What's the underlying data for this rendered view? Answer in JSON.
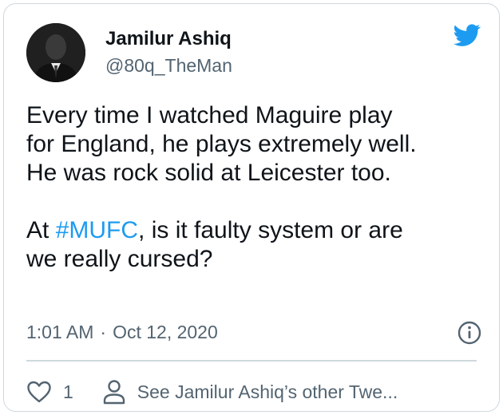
{
  "author": {
    "name": "Jamilur Ashiq",
    "handle": "@80q_TheMan"
  },
  "tweet": {
    "text_before_hashtag": "Every time I watched Maguire play\nfor England, he plays extremely well.\nHe was rock solid at Leicester too.\n\nAt ",
    "hashtag": "#MUFC",
    "text_after_hashtag": ", is it faulty system or are\nwe really cursed?",
    "time": "1:01 AM",
    "separator": "·",
    "date": "Oct 12, 2020"
  },
  "actions": {
    "like_count": "1",
    "profile_link_label": "See Jamilur Ashiq’s other Twe..."
  },
  "colors": {
    "brand": "#1d9bf0",
    "secondary_text": "#536471"
  },
  "icons": [
    "twitter-bird-icon",
    "info-icon",
    "heart-icon",
    "person-icon"
  ]
}
